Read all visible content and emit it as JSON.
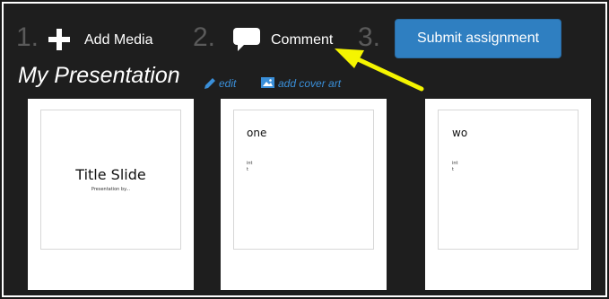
{
  "toolbar": {
    "steps": [
      {
        "number": "1.",
        "label": "Add Media",
        "icon": "plus-icon"
      },
      {
        "number": "2.",
        "label": "Comment",
        "icon": "speech-bubble-icon"
      },
      {
        "number": "3.",
        "label": "",
        "icon": ""
      }
    ],
    "submit_label": "Submit assignment"
  },
  "presentation": {
    "title": "My Presentation",
    "edit_label": "edit",
    "edit_icon": "pencil-icon",
    "cover_art_label": "add cover art",
    "cover_art_icon": "image-icon"
  },
  "slides": [
    {
      "title": "Title Slide",
      "subtitle": "Presentation by..."
    },
    {
      "title": "one",
      "bullets": "int\nt"
    },
    {
      "title": "wo",
      "bullets": "int\nt"
    }
  ],
  "annotation": {
    "arrow_color": "#f5f500",
    "arrow_icon": "pointer-arrow-icon"
  },
  "colors": {
    "background": "#1e1e1e",
    "accent": "#2f7fc1",
    "link": "#3a8fd9",
    "step_number": "#5a5a5a"
  }
}
